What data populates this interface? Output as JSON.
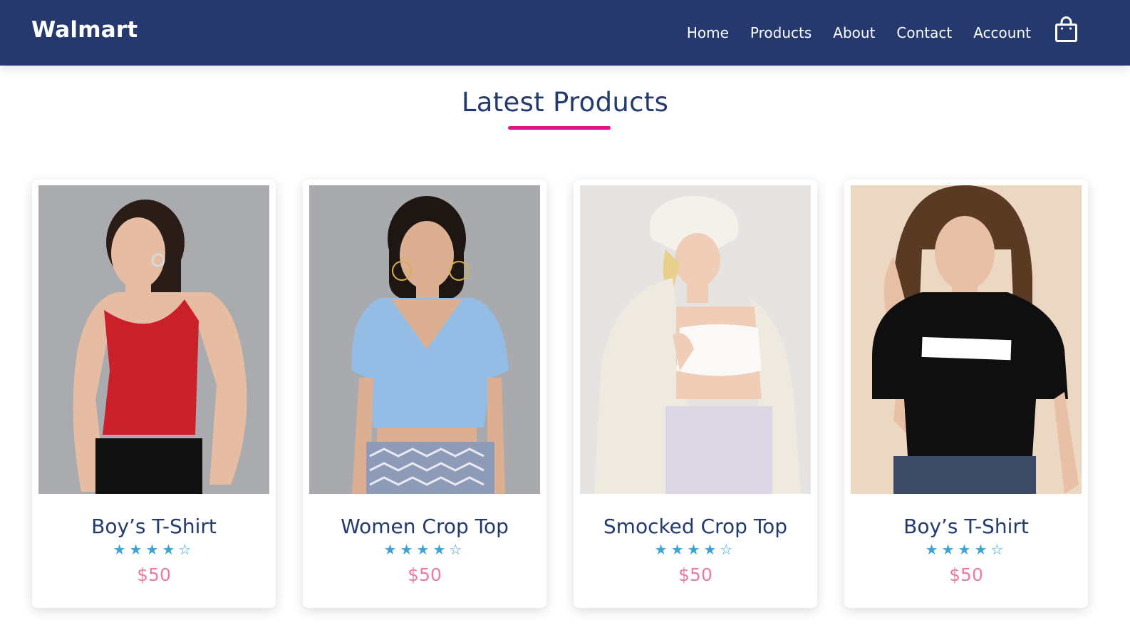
{
  "header": {
    "brand": "Walmart",
    "nav": [
      "Home",
      "Products",
      "About",
      "Contact",
      "Account"
    ],
    "cart_icon": "shopping-bag-icon"
  },
  "section": {
    "title": "Latest Products"
  },
  "products": [
    {
      "title": "Boy’s T-Shirt",
      "rating": "★★★★☆",
      "rating_value": 4,
      "rating_max": 5,
      "price": "$50"
    },
    {
      "title": "Women Crop Top",
      "rating": "★★★★☆",
      "rating_value": 4,
      "rating_max": 5,
      "price": "$50"
    },
    {
      "title": "Smocked Crop Top",
      "rating": "★★★★☆",
      "rating_value": 4,
      "rating_max": 5,
      "price": "$50"
    },
    {
      "title": "Boy’s T-Shirt",
      "rating": "★★★★☆",
      "rating_value": 4,
      "rating_max": 5,
      "price": "$50"
    }
  ],
  "colors": {
    "navbar": "#25396f",
    "accent_underline": "#e0148f",
    "star": "#3aa3d6",
    "price": "#ea7ba4"
  }
}
